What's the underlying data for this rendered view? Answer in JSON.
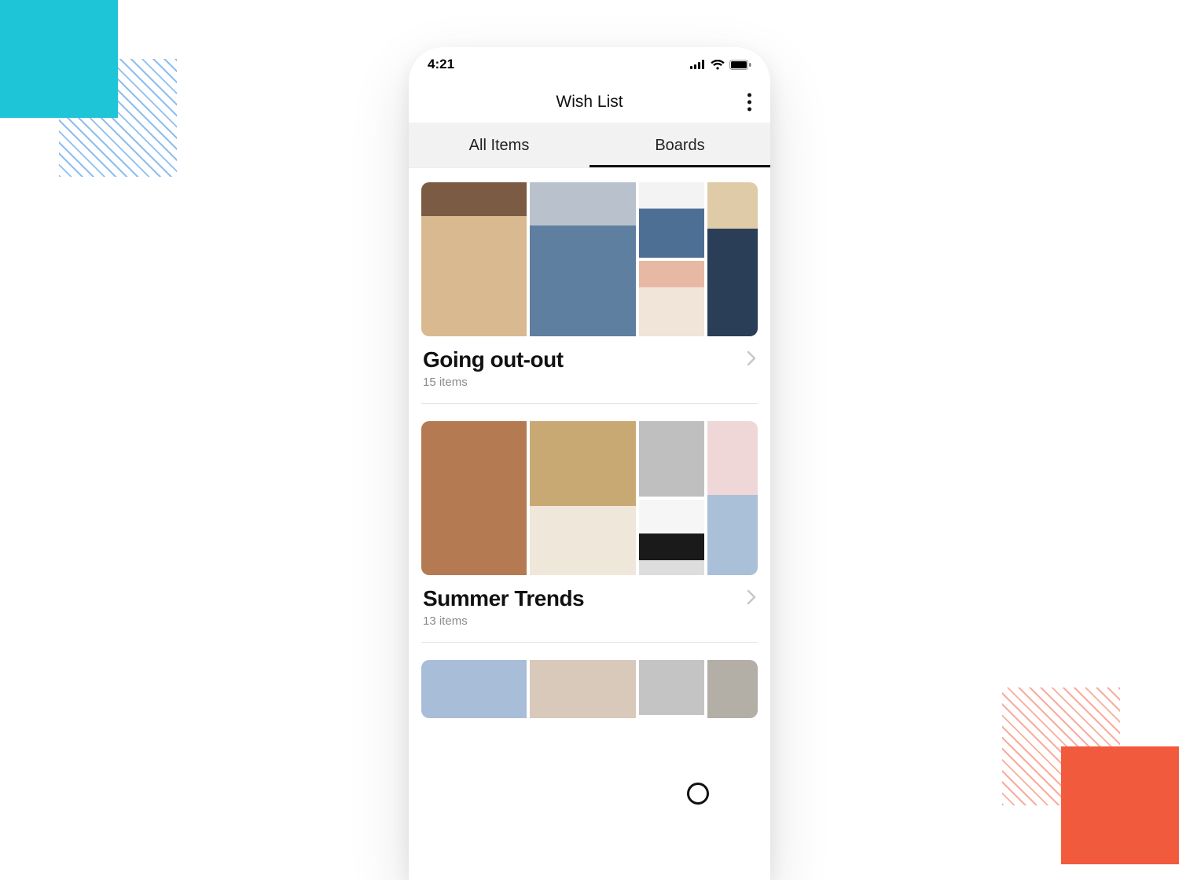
{
  "status": {
    "time": "4:21"
  },
  "header": {
    "title": "Wish List"
  },
  "tabs": [
    {
      "label": "All Items",
      "active": false
    },
    {
      "label": "Boards",
      "active": true
    }
  ],
  "boards": [
    {
      "title": "Going out-out",
      "subtitle": "15 items"
    },
    {
      "title": "Summer Trends",
      "subtitle": "13 items"
    }
  ]
}
